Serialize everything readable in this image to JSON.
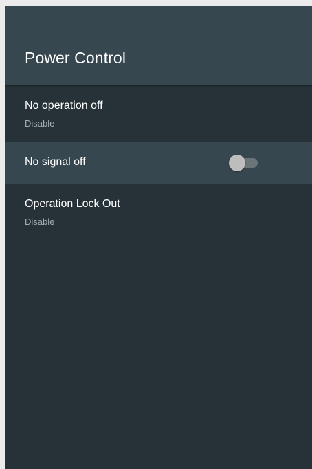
{
  "header": {
    "title": "Power Control"
  },
  "settings": [
    {
      "label": "No operation off",
      "value": "Disable"
    },
    {
      "label": "No signal off",
      "toggle_on": false
    },
    {
      "label": "Operation Lock Out",
      "value": "Disable"
    }
  ],
  "colors": {
    "page_background": "#263238",
    "header_background": "#37474f",
    "focused_row": "#37474f",
    "toggle_thumb": "#bdbdbd",
    "toggle_track": "#6b7478"
  }
}
